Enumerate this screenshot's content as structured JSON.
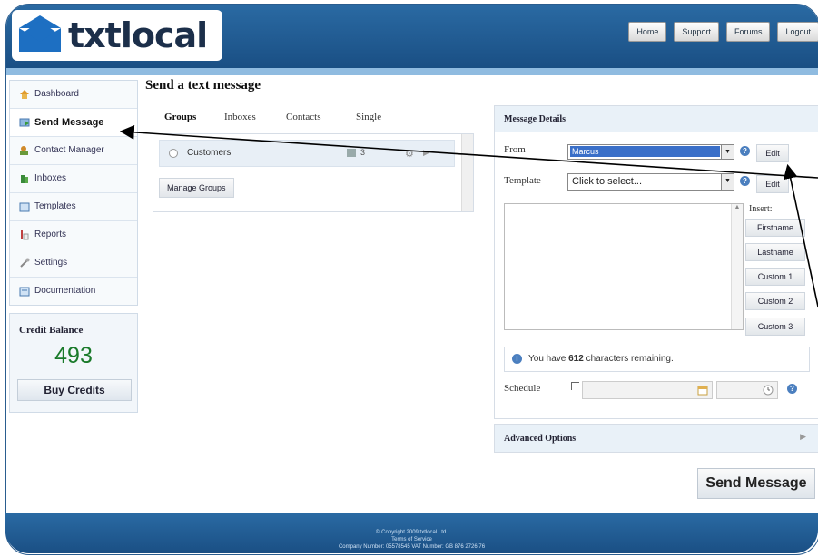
{
  "brand": {
    "logo_text": "txtlocal"
  },
  "topnav": [
    "Home",
    "Support",
    "Forums",
    "Logout"
  ],
  "sidebar": {
    "items": [
      {
        "label": "Dashboard",
        "icon": "home-icon"
      },
      {
        "label": "Send Message",
        "icon": "send-icon"
      },
      {
        "label": "Contact Manager",
        "icon": "contacts-icon"
      },
      {
        "label": "Inboxes",
        "icon": "inbox-icon"
      },
      {
        "label": "Templates",
        "icon": "template-icon"
      },
      {
        "label": "Reports",
        "icon": "reports-icon"
      },
      {
        "label": "Settings",
        "icon": "wrench-icon"
      },
      {
        "label": "Documentation",
        "icon": "document-icon"
      }
    ],
    "active_index": 1
  },
  "credit": {
    "title": "Credit Balance",
    "value": "493",
    "buy_label": "Buy Credits"
  },
  "main": {
    "title": "Send a text message",
    "tabs": [
      "Groups",
      "Inboxes",
      "Contacts",
      "Single"
    ],
    "groups": [
      {
        "name": "Customers",
        "count": "3"
      }
    ],
    "manage_groups_label": "Manage Groups"
  },
  "details": {
    "title": "Message Details",
    "from_label": "From",
    "from_value": "Marcus",
    "edit_label": "Edit",
    "template_label": "Template",
    "template_value": "Click to select...",
    "insert_label": "Insert:",
    "insert_buttons": [
      "Firstname",
      "Lastname",
      "Custom 1",
      "Custom 2",
      "Custom 3"
    ],
    "chars_prefix": "You have ",
    "chars_count": "612",
    "chars_suffix": " characters remaining.",
    "schedule_label": "Schedule"
  },
  "advanced_title": "Advanced Options",
  "send_label": "Send Message",
  "footer": {
    "copyright": "© Copyright 2009 txtlocal Ltd.",
    "terms": "Terms of Service",
    "company": "Company Number: 05578545 VAT Number: GB 876 2726 76"
  },
  "colors": {
    "header": "#1f5a92",
    "accent": "#3a6fc8",
    "credit": "#1a7a2a"
  }
}
